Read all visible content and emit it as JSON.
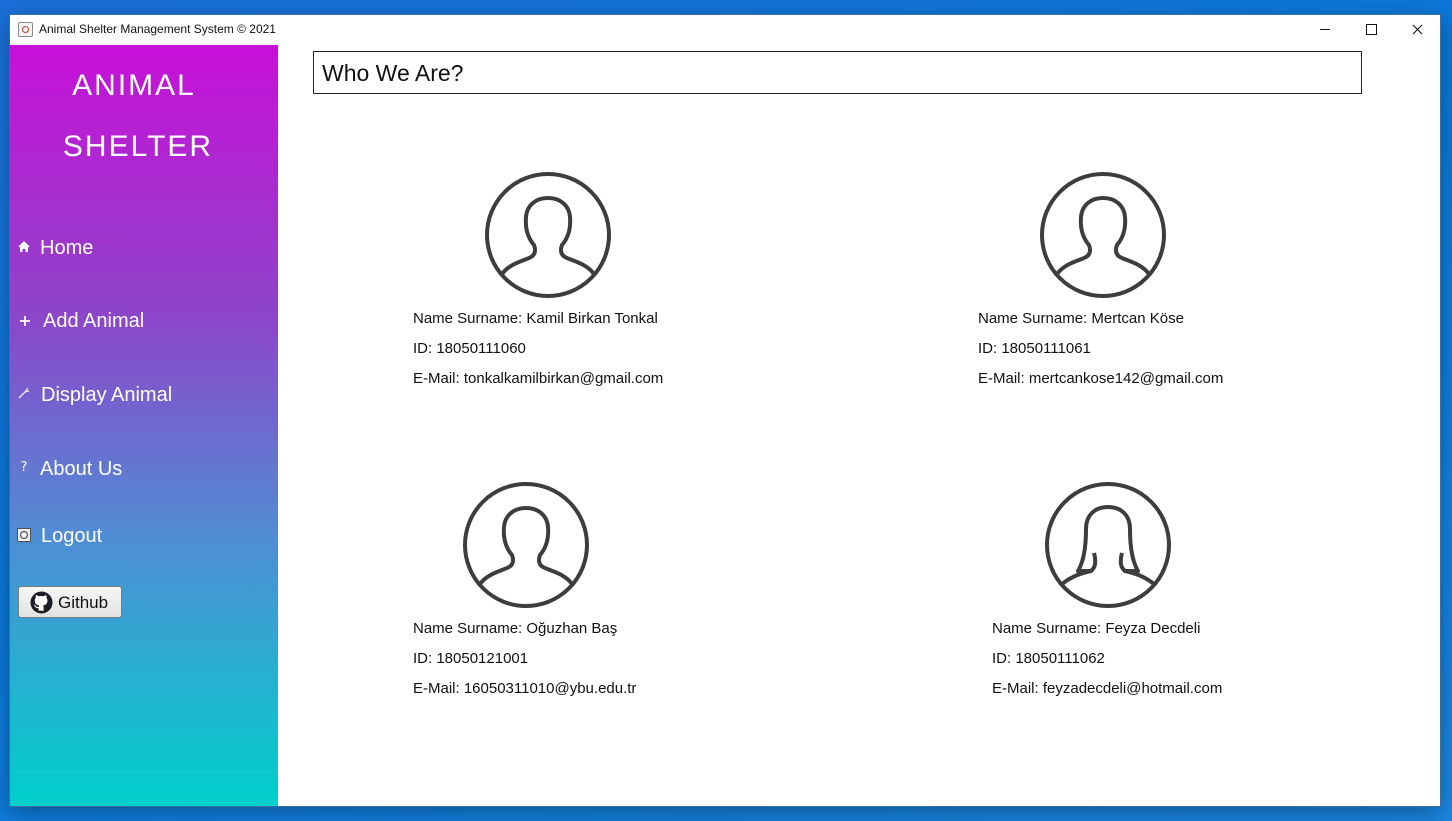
{
  "window": {
    "title": "Animal Shelter Management System © 2021"
  },
  "sidebar": {
    "brand_line1": "ANIMAL",
    "brand_line2": "SHELTER",
    "items": [
      {
        "label": "Home",
        "icon": "home-icon"
      },
      {
        "label": "Add Animal",
        "icon": "plus-icon"
      },
      {
        "label": "Display Animal",
        "icon": "wrench-icon"
      },
      {
        "label": "About Us",
        "icon": "question-icon"
      },
      {
        "label": "Logout",
        "icon": "logout-icon"
      }
    ],
    "github_label": "Github"
  },
  "main": {
    "heading": "Who We Are?",
    "members": [
      {
        "name": "Name Surname: Kamil Birkan Tonkal",
        "id": "ID: 18050111060",
        "email": "E-Mail: tonkalkamilbirkan@gmail.com",
        "avatar": "male-avatar-icon"
      },
      {
        "name": "Name Surname: Mertcan Köse",
        "id": "ID: 18050111061",
        "email": "E-Mail: mertcankose142@gmail.com",
        "avatar": "male-avatar-icon"
      },
      {
        "name": "Name Surname: Oğuzhan Baş",
        "id": "ID: 18050121001",
        "email": "E-Mail: 16050311010@ybu.edu.tr",
        "avatar": "male-avatar-icon"
      },
      {
        "name": "Name Surname: Feyza Decdeli",
        "id": "ID: 18050111062",
        "email": "E-Mail: feyzadecdeli@hotmail.com",
        "avatar": "female-avatar-icon"
      }
    ]
  }
}
